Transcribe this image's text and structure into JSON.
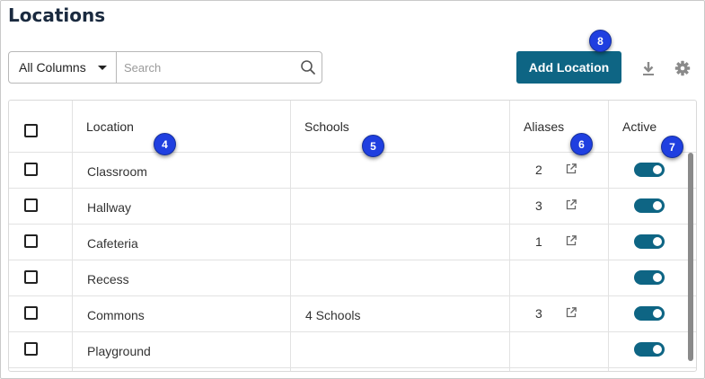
{
  "page": {
    "title": "Locations"
  },
  "toolbar": {
    "column_filter": "All Columns",
    "search_placeholder": "Search",
    "add_label": "Add Location",
    "accent_color": "#0e6584"
  },
  "table": {
    "headers": {
      "location": "Location",
      "schools": "Schools",
      "aliases": "Aliases",
      "active": "Active"
    },
    "rows": [
      {
        "location": "Classroom",
        "schools": "",
        "aliases": "2",
        "has_alias_link": true,
        "active": true
      },
      {
        "location": "Hallway",
        "schools": "",
        "aliases": "3",
        "has_alias_link": true,
        "active": true
      },
      {
        "location": "Cafeteria",
        "schools": "",
        "aliases": "1",
        "has_alias_link": true,
        "active": true
      },
      {
        "location": "Recess",
        "schools": "",
        "aliases": "",
        "has_alias_link": false,
        "active": true
      },
      {
        "location": "Commons",
        "schools": "4 Schools",
        "aliases": "3",
        "has_alias_link": true,
        "active": true
      },
      {
        "location": "Playground",
        "schools": "",
        "aliases": "",
        "has_alias_link": false,
        "active": true
      }
    ]
  },
  "markers": {
    "location": "4",
    "schools": "5",
    "aliases": "6",
    "active": "7",
    "add": "8"
  },
  "icons": {
    "search": "search-icon",
    "download": "download-icon",
    "settings": "gear-icon",
    "external": "external-link-icon",
    "dropdown": "caret-down-icon"
  }
}
